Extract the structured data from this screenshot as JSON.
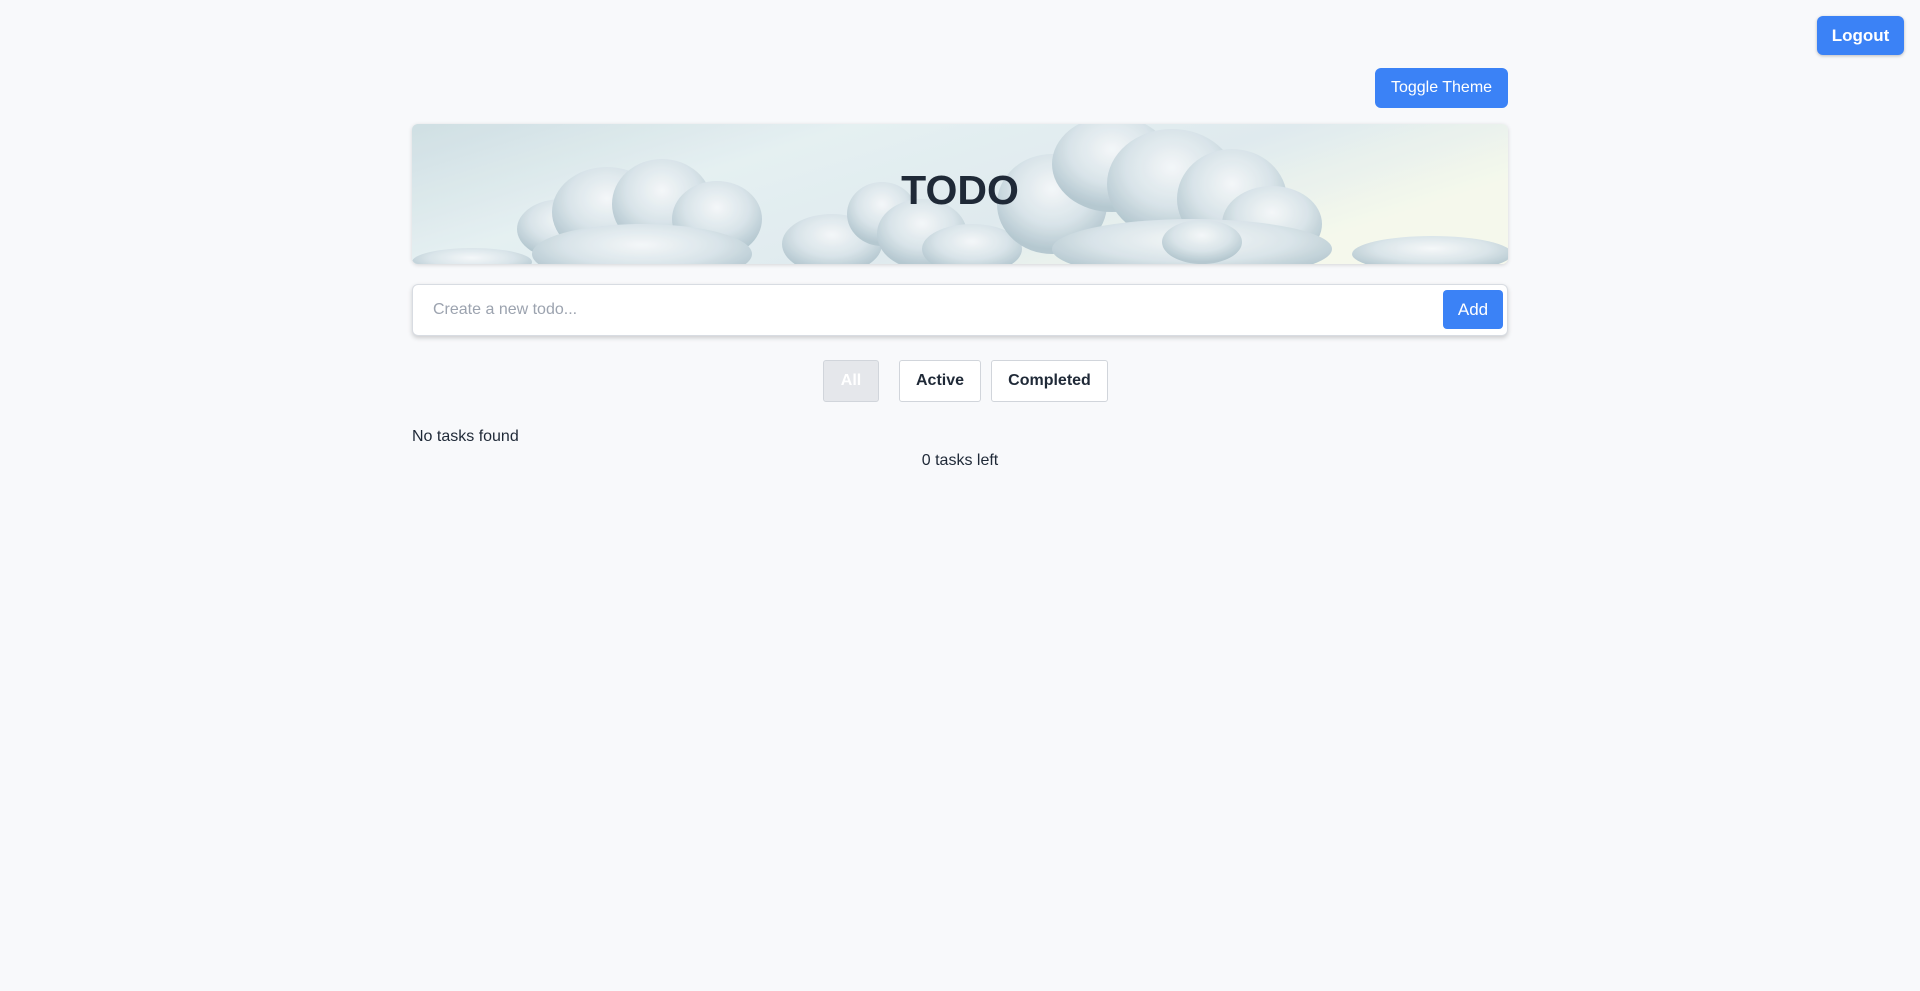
{
  "header": {
    "logout_label": "Logout",
    "toggle_theme_label": "Toggle Theme"
  },
  "banner": {
    "title": "TODO"
  },
  "new_todo": {
    "placeholder": "Create a new todo...",
    "value": "",
    "add_label": "Add"
  },
  "filters": {
    "items": [
      {
        "label": "All",
        "selected": true
      },
      {
        "label": "Active",
        "selected": false
      },
      {
        "label": "Completed",
        "selected": false
      }
    ]
  },
  "list": {
    "empty_message": "No tasks found"
  },
  "footer": {
    "tasks_left": "0 tasks left"
  },
  "colors": {
    "accent": "#3b82f6",
    "background": "#f8f9fb",
    "text": "#1f2937"
  }
}
